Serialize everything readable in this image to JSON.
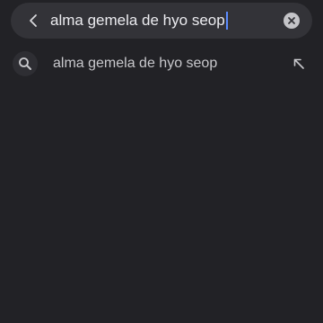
{
  "search": {
    "query": "alma gemela de hyo seop"
  },
  "suggestions": [
    {
      "text": "alma gemela de hyo seop",
      "icon": "search-icon",
      "action_icon": "arrow-up-left-icon"
    }
  ],
  "icons": {
    "back": "chevron-left-icon",
    "clear": "clear-circle-icon"
  },
  "colors": {
    "background": "#222226",
    "search_bar": "#333338",
    "caret": "#5b8cff",
    "text_primary": "#ececf0",
    "text_secondary": "#c8c8cc"
  }
}
